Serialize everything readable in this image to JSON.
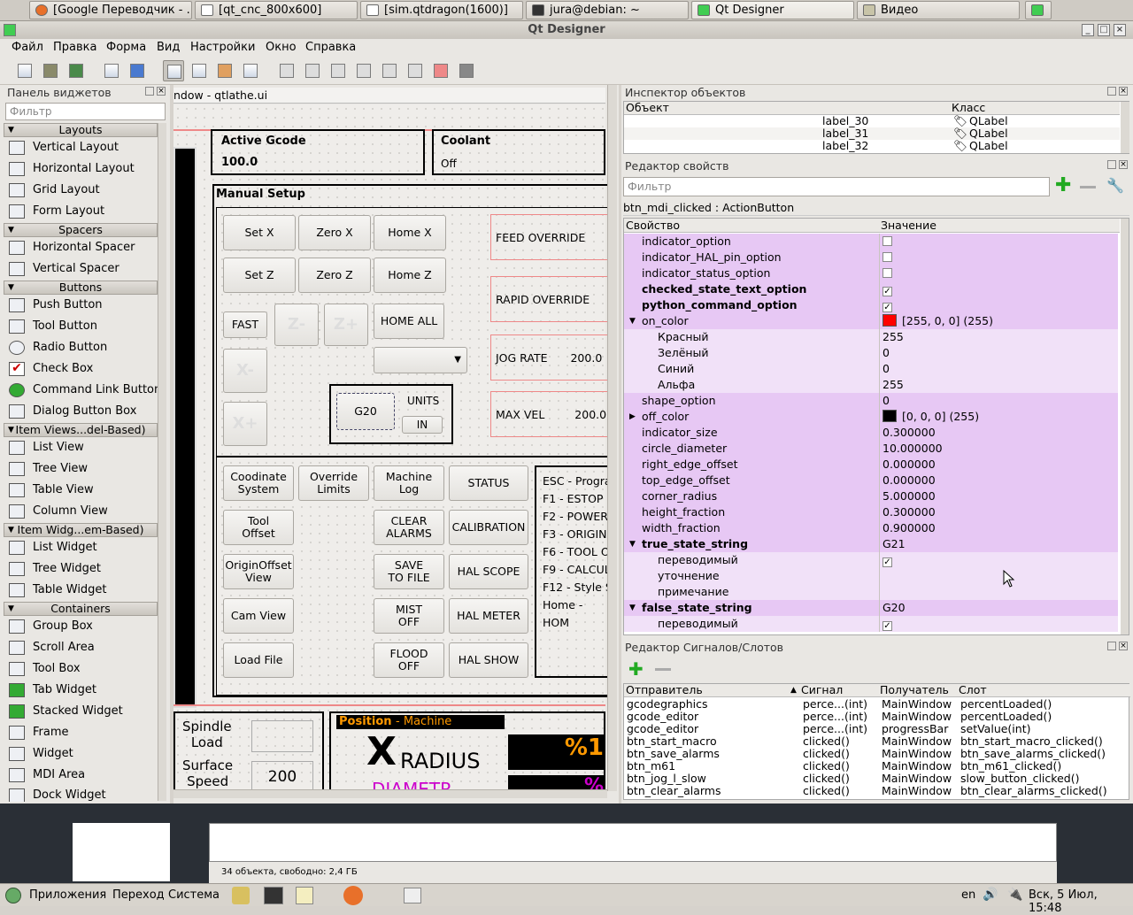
{
  "taskbar_top": {
    "tabs": [
      "[Google Переводчик - ...",
      "[qt_cnc_800x600]",
      "[sim.qtdragon(1600)]",
      "jura@debian: ~",
      "Qt Designer",
      "Видео"
    ]
  },
  "window": {
    "title": "Qt Designer"
  },
  "menubar": {
    "items": [
      "Файл",
      "Правка",
      "Форма",
      "Вид",
      "Настройки",
      "Окно",
      "Справка"
    ]
  },
  "widget_box": {
    "title": "Панель виджетов",
    "filter_placeholder": "Фильтр",
    "categories": [
      "Layouts",
      "Spacers",
      "Buttons",
      "Item Views...del-Based)",
      "Item Widg...em-Based)",
      "Containers"
    ],
    "layouts": [
      "Vertical Layout",
      "Horizontal Layout",
      "Grid Layout",
      "Form Layout"
    ],
    "spacers": [
      "Horizontal Spacer",
      "Vertical Spacer"
    ],
    "buttons": [
      "Push Button",
      "Tool Button",
      "Radio Button",
      "Check Box",
      "Command Link Button",
      "Dialog Button Box"
    ],
    "item_views": [
      "List View",
      "Tree View",
      "Table View",
      "Column View"
    ],
    "item_widgets": [
      "List Widget",
      "Tree Widget",
      "Table Widget"
    ],
    "containers": [
      "Group Box",
      "Scroll Area",
      "Tool Box",
      "Tab Widget",
      "Stacked Widget",
      "Frame",
      "Widget",
      "MDI Area",
      "Dock Widget"
    ]
  },
  "form": {
    "subwindow_title": "ndow - qtlathe.ui",
    "active_gcode_title": "Active Gcode",
    "active_gcode_value": "100.0",
    "coolant_title": "Coolant",
    "coolant_value": "Off",
    "manual_setup": "Manual Setup",
    "btn_set_x": "Set X",
    "btn_zero_x": "Zero X",
    "btn_home_x": "Home X",
    "btn_set_z": "Set Z",
    "btn_zero_z": "Zero Z",
    "btn_home_z": "Home Z",
    "btn_fast": "FAST",
    "btn_home_all": "HOME ALL",
    "feed_override": "FEED OVERRIDE",
    "rapid_override": "RAPID OVERRIDE",
    "jog_rate": "JOG RATE",
    "jog_rate_value": "200.0",
    "max_vel": "MAX VEL",
    "max_vel_value": "200.0",
    "z_minus": "Z-",
    "z_plus": "Z+",
    "x_minus": "X-",
    "x_plus": "X+",
    "g20": "G20",
    "units": "UNITS",
    "units_in": "IN",
    "buttons_row": [
      [
        "Coodinate\nSystem",
        "Override\nLimits",
        "Machine\nLog",
        "STATUS"
      ],
      [
        "Tool\nOffset",
        "",
        "CLEAR\nALARMS",
        "CALIBRATION"
      ],
      [
        "OriginOffset\nView",
        "",
        "SAVE\nTO FILE",
        "HAL SCOPE"
      ],
      [
        "Cam View",
        "",
        "MIST\nOFF",
        "HAL METER"
      ],
      [
        "Load File",
        "",
        "FLOOD\nOFF",
        "HAL SHOW"
      ]
    ],
    "keys": [
      "ESC - Progra",
      "F1 - ESTOP",
      "F2 - POWER",
      "F3 - ORIGIN(",
      "F6 - TOOL O",
      "F9 - CALCUL",
      "F12 - Style S",
      "Home - HOM"
    ],
    "spindle_load": "Spindle\nLoad",
    "surface_speed": "Surface\nSpeed",
    "surface_speed_value": "200",
    "position_title": "Position",
    "position_sub": "- Machine",
    "x_big": "X",
    "radius": "RADIUS",
    "diametr": "DIAMETR",
    "pct1": "%1",
    "pct2": "%"
  },
  "object_inspector": {
    "title": "Инспектор объектов",
    "col_object": "Объект",
    "col_class": "Класс",
    "rows": [
      [
        "label_30",
        "QLabel"
      ],
      [
        "label_31",
        "QLabel"
      ],
      [
        "label_32",
        "QLabel"
      ]
    ]
  },
  "property_editor": {
    "title": "Редактор свойств",
    "filter_placeholder": "Фильтр",
    "object": "btn_mdi_clicked : ActionButton",
    "col_property": "Свойство",
    "col_value": "Значение",
    "rows": [
      {
        "k": "indicator_option",
        "v": "",
        "c": "empty",
        "lvl": 0
      },
      {
        "k": "indicator_HAL_pin_option",
        "v": "",
        "c": "empty",
        "lvl": 0
      },
      {
        "k": "indicator_status_option",
        "v": "",
        "c": "empty",
        "lvl": 0
      },
      {
        "k": "checked_state_text_option",
        "v": "",
        "c": "check",
        "lvl": 0,
        "b": true
      },
      {
        "k": "python_command_option",
        "v": "",
        "c": "check",
        "lvl": 0,
        "b": true
      },
      {
        "k": "on_color",
        "v": "[255, 0, 0] (255)",
        "c": "red",
        "lvl": 0,
        "exp": "down"
      },
      {
        "k": "Красный",
        "v": "255",
        "lvl": 1
      },
      {
        "k": "Зелёный",
        "v": "0",
        "lvl": 1
      },
      {
        "k": "Синий",
        "v": "0",
        "lvl": 1
      },
      {
        "k": "Альфа",
        "v": "255",
        "lvl": 1
      },
      {
        "k": "shape_option",
        "v": "0",
        "lvl": 0
      },
      {
        "k": "off_color",
        "v": "[0, 0, 0] (255)",
        "c": "black",
        "lvl": 0,
        "exp": "right"
      },
      {
        "k": "indicator_size",
        "v": "0.300000",
        "lvl": 0
      },
      {
        "k": "circle_diameter",
        "v": "10.000000",
        "lvl": 0
      },
      {
        "k": "right_edge_offset",
        "v": "0.000000",
        "lvl": 0
      },
      {
        "k": "top_edge_offset",
        "v": "0.000000",
        "lvl": 0
      },
      {
        "k": "corner_radius",
        "v": "5.000000",
        "lvl": 0
      },
      {
        "k": "height_fraction",
        "v": "0.300000",
        "lvl": 0
      },
      {
        "k": "width_fraction",
        "v": "0.900000",
        "lvl": 0
      },
      {
        "k": "true_state_string",
        "v": "G21",
        "lvl": 0,
        "b": true,
        "exp": "down"
      },
      {
        "k": "переводимый",
        "v": "",
        "c": "check",
        "lvl": 1
      },
      {
        "k": "уточнение",
        "v": "",
        "lvl": 1
      },
      {
        "k": "примечание",
        "v": "",
        "lvl": 1
      },
      {
        "k": "false_state_string",
        "v": "G20",
        "lvl": 0,
        "b": true,
        "exp": "down"
      },
      {
        "k": "переводимый",
        "v": "",
        "c": "check",
        "lvl": 1
      }
    ]
  },
  "signal_editor": {
    "title": "Редактор Сигналов/Слотов",
    "cols": [
      "Отправитель",
      "Сигнал",
      "Получатель",
      "Слот"
    ],
    "rows": [
      [
        "gcodegraphics",
        "perce...(int)",
        "MainWindow",
        "percentLoaded()"
      ],
      [
        "gcode_editor",
        "perce...(int)",
        "MainWindow",
        "percentLoaded()"
      ],
      [
        "gcode_editor",
        "perce...(int)",
        "progressBar",
        "setValue(int)"
      ],
      [
        "btn_start_macro",
        "clicked()",
        "MainWindow",
        "btn_start_macro_clicked()"
      ],
      [
        "btn_save_alarms",
        "clicked()",
        "MainWindow",
        "btn_save_alarms_clicked()"
      ],
      [
        "btn_m61",
        "clicked()",
        "MainWindow",
        "btn_m61_clicked()"
      ],
      [
        "btn_jog_l_slow",
        "clicked()",
        "MainWindow",
        "slow_button_clicked()"
      ],
      [
        "btn_clear_alarms",
        "clicked()",
        "MainWindow",
        "btn_clear_alarms_clicked()"
      ]
    ]
  },
  "file_manager_status": "34 объекта, свободно: 2,4 ГБ",
  "bottom_panel": {
    "apps": "Приложения",
    "places": "Переход",
    "system": "Система",
    "lang": "en",
    "clock": "Вск,  5 Июл, 15:48"
  },
  "colors": {
    "on_color": "#ff0000",
    "off_color": "#000000",
    "row_violet": "#e7c8f4",
    "row_violet_light": "#f1e1f8"
  }
}
